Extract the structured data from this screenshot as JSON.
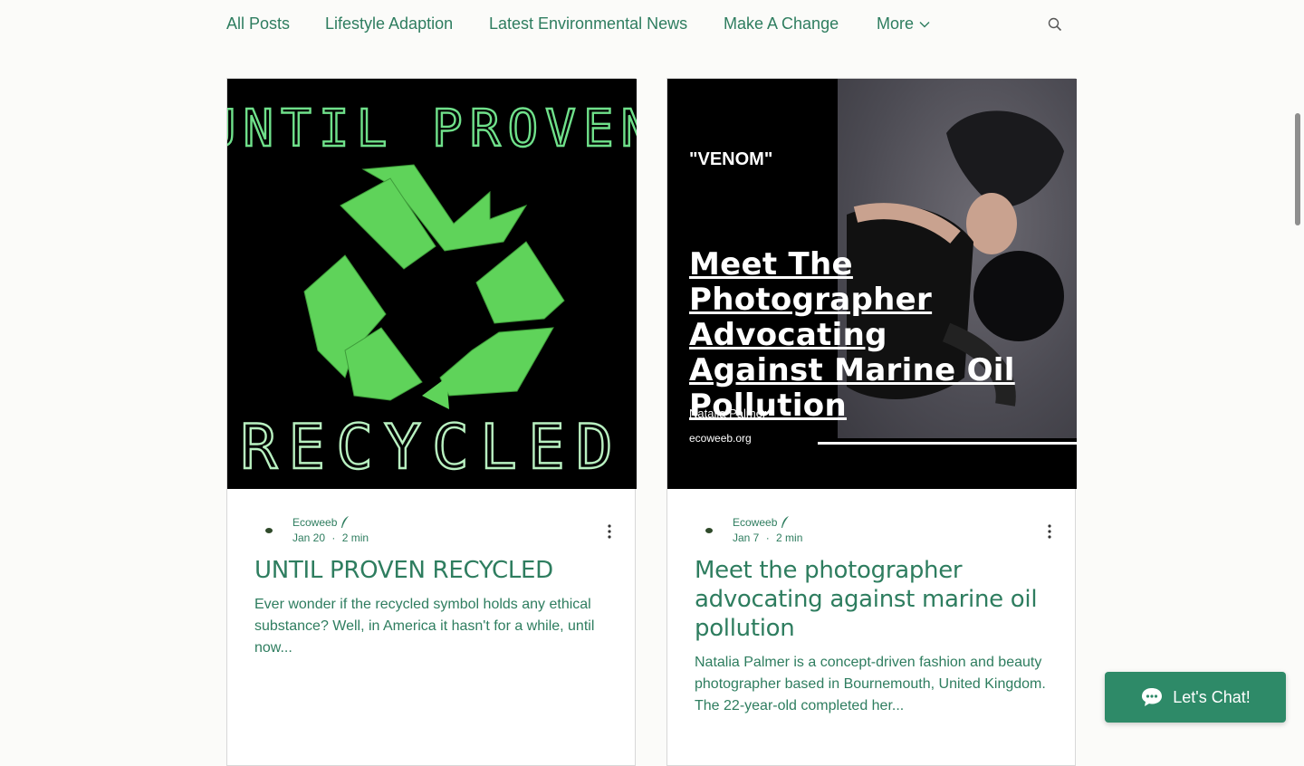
{
  "nav": {
    "items": [
      {
        "label": "All Posts"
      },
      {
        "label": "Lifestyle Adaption"
      },
      {
        "label": "Latest Environmental News"
      },
      {
        "label": "Make A Change"
      }
    ],
    "more_label": "More"
  },
  "colors": {
    "accent": "#2e7d5f",
    "chat": "#2e8a68",
    "neon_green": "#6fe08a"
  },
  "posts": [
    {
      "cover_top_text": "UNTIL PROVEN",
      "cover_bottom_text": "RECYCLED",
      "author": "Ecoweeb",
      "date": "Jan 20",
      "read_time": "2 min",
      "title": "UNTIL PROVEN RECYCLED",
      "excerpt": "Ever wonder if the recycled symbol holds any ethical substance? Well, in America it hasn't for a while, until now..."
    },
    {
      "cover_label": "\"VENOM\"",
      "cover_headline": "Meet The Photographer Advocating Against Marine Oil Pollution",
      "cover_name": "Natalia Palmer",
      "cover_url": "ecoweeb.org",
      "author": "Ecoweeb",
      "date": "Jan 7",
      "read_time": "2 min",
      "title": "Meet the photographer advocating against marine oil pollution",
      "excerpt": "Natalia Palmer is a concept-driven fashion and beauty photographer based in Bournemouth, United Kingdom. The 22-year-old completed her..."
    }
  ],
  "chat": {
    "label": "Let's Chat!"
  },
  "icons": [
    "search-icon",
    "chevron-down-icon",
    "quill-icon",
    "more-vertical-icon",
    "chat-bubble-icon",
    "recycle-icon"
  ]
}
